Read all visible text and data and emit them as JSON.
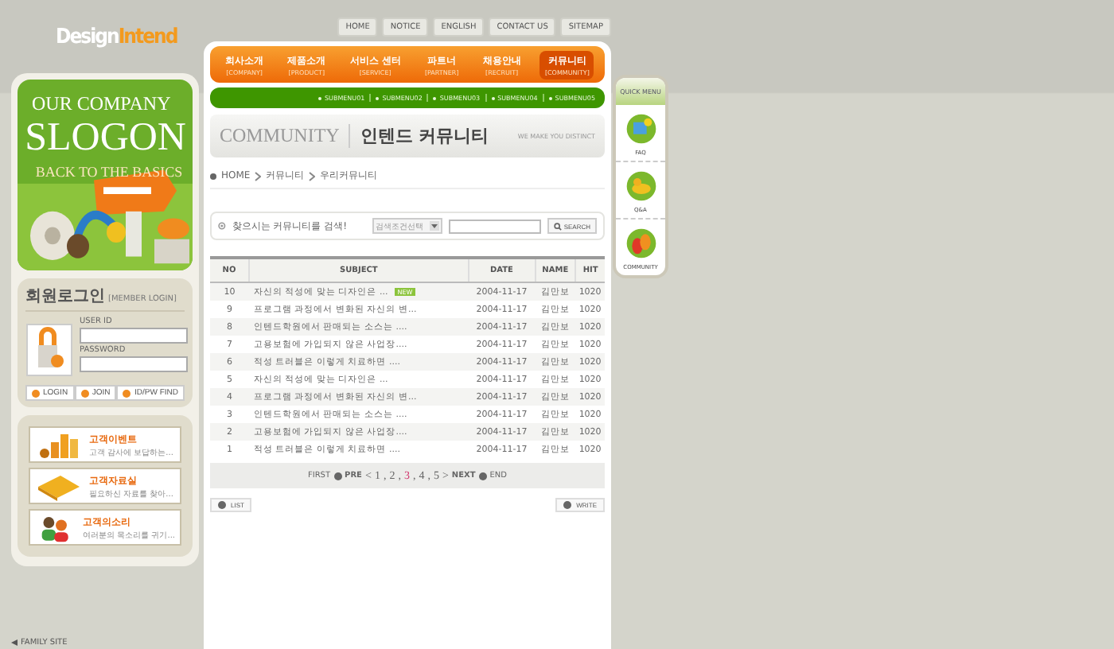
{
  "logo": {
    "word1": "Design",
    "word2": "Intend"
  },
  "top_links": [
    "HOME",
    "NOTICE",
    "ENGLISH",
    "CONTACT US",
    "SITEMAP"
  ],
  "banner": {
    "line1": "OUR COMPANY",
    "line2": "SLOGON",
    "line3": "BACK TO THE BASICS"
  },
  "login": {
    "title": "회원로그인",
    "subtitle": "[MEMBER LOGIN]",
    "user_label": "USER ID",
    "password_label": "PASSWORD",
    "buttons": [
      "LOGIN",
      "JOIN",
      "ID/PW FIND"
    ]
  },
  "service_cards": [
    {
      "kind": "event",
      "title": "고객이벤트",
      "desc": "고객 감사에 보답하는..."
    },
    {
      "kind": "archive",
      "title": "고객자료실",
      "desc": "필요하신 자료를 찾아..."
    },
    {
      "kind": "voice",
      "title": "고객의소리",
      "desc": "여러분의 목소리를 귀기..."
    }
  ],
  "family_site": "FAMILY SITE",
  "main_menu": [
    {
      "label": "회사소개",
      "sub": "[COMPANY]",
      "selected": false
    },
    {
      "label": "제품소개",
      "sub": "[PRODUCT]",
      "selected": false
    },
    {
      "label": "서비스 센터",
      "sub": "[SERVICE]",
      "selected": false
    },
    {
      "label": "파트너",
      "sub": "[PARTNER]",
      "selected": false
    },
    {
      "label": "채용안내",
      "sub": "[RECRUIT]",
      "selected": false
    },
    {
      "label": "커뮤니티",
      "sub": "[COMMUNITY]",
      "selected": true
    }
  ],
  "submenu": [
    "SUBMENU01",
    "SUBMENU02",
    "SUBMENU03",
    "SUBMENU04",
    "SUBMENU05"
  ],
  "page_header": {
    "english": "COMMUNITY",
    "title": "인텐드 커뮤니티",
    "tagline": "WE MAKE YOU DISTINCT"
  },
  "breadcrumb": [
    "HOME",
    "커뮤니티",
    "우리커뮤니티"
  ],
  "search": {
    "label": "찾으시는 커뮤니티를 검색!",
    "select": "검색조건선택",
    "button": "SEARCH"
  },
  "table": {
    "columns": [
      "NO",
      "SUBJECT",
      "DATE",
      "NAME",
      "HIT"
    ],
    "rows": [
      {
        "no": "10",
        "subject": "자신의 적성에 맞는 디자인은 ...",
        "new": true,
        "new_label": "NEW",
        "date": "2004-11-17",
        "name": "김만보",
        "hit": "1020"
      },
      {
        "no": "9",
        "subject": "프로그램 과정에서 변화된 자신의 변...",
        "new": false,
        "date": "2004-11-17",
        "name": "김만보",
        "hit": "1020"
      },
      {
        "no": "8",
        "subject": "인텐드학원에서 판매되는 소스는 ....",
        "new": false,
        "date": "2004-11-17",
        "name": "김만보",
        "hit": "1020"
      },
      {
        "no": "7",
        "subject": "고용보험에 가입되지 않은 사업장....",
        "new": false,
        "date": "2004-11-17",
        "name": "김만보",
        "hit": "1020"
      },
      {
        "no": "6",
        "subject": "적성 트러블은 이렇게 치료하면 ....",
        "new": false,
        "date": "2004-11-17",
        "name": "김만보",
        "hit": "1020"
      },
      {
        "no": "5",
        "subject": "자신의 적성에 맞는 디자인은 ...",
        "new": false,
        "date": "2004-11-17",
        "name": "김만보",
        "hit": "1020"
      },
      {
        "no": "4",
        "subject": "프로그램 과정에서 변화된 자신의 변...",
        "new": false,
        "date": "2004-11-17",
        "name": "김만보",
        "hit": "1020"
      },
      {
        "no": "3",
        "subject": "인텐드학원에서 판매되는 소스는 ....",
        "new": false,
        "date": "2004-11-17",
        "name": "김만보",
        "hit": "1020"
      },
      {
        "no": "2",
        "subject": "고용보험에 가입되지 않은 사업장....",
        "new": false,
        "date": "2004-11-17",
        "name": "김만보",
        "hit": "1020"
      },
      {
        "no": "1",
        "subject": "적성 트러블은 이렇게 치료하면 ....",
        "new": false,
        "date": "2004-11-17",
        "name": "김만보",
        "hit": "1020"
      }
    ]
  },
  "pagination": {
    "first": "FIRST",
    "prev": "PRE",
    "open": "<",
    "close": ">",
    "separator": ",",
    "pages": [
      {
        "label": "1",
        "selected": false
      },
      {
        "label": "2",
        "selected": false
      },
      {
        "label": "3",
        "selected": true
      },
      {
        "label": "4",
        "selected": false
      },
      {
        "label": "5",
        "selected": false
      }
    ],
    "next": "NEXT",
    "last": "END"
  },
  "actions": {
    "list": "LIST",
    "write": "WRITE"
  },
  "quick_menu": {
    "title": "QUICK MENU",
    "items": [
      {
        "kind": "faq",
        "label": "FAQ"
      },
      {
        "kind": "qna",
        "label": "Q&A"
      },
      {
        "kind": "community",
        "label": "COMMUNITY"
      }
    ]
  }
}
